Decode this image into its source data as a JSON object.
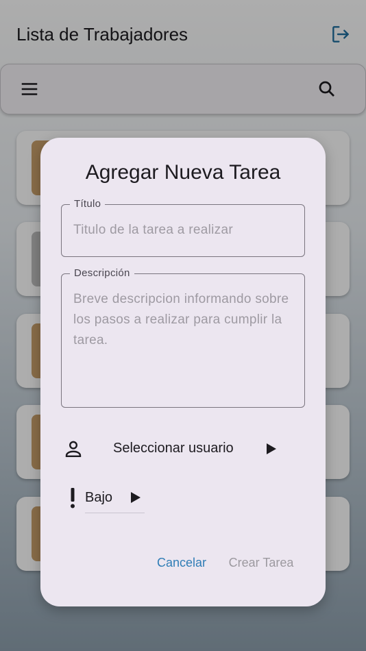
{
  "app": {
    "title": "Lista de Trabajadores",
    "icons": {
      "logout": "logout-icon",
      "menu": "menu-icon",
      "search": "search-icon"
    },
    "accent_color": "#2f7db6"
  },
  "dialog": {
    "title": "Agregar Nueva Tarea",
    "title_field": {
      "label": "Título",
      "placeholder": "Titulo de la tarea a realizar",
      "value": ""
    },
    "description_field": {
      "label": "Descripción",
      "placeholder": "Breve descripcion informando sobre los pasos a realizar para cumplir la tarea.",
      "value": ""
    },
    "user_select": {
      "label": "Seleccionar usuario",
      "icon": "person-icon"
    },
    "priority_select": {
      "value": "Bajo",
      "icon": "priority-high-icon"
    },
    "actions": {
      "cancel": "Cancelar",
      "create": "Crear Tarea"
    }
  }
}
